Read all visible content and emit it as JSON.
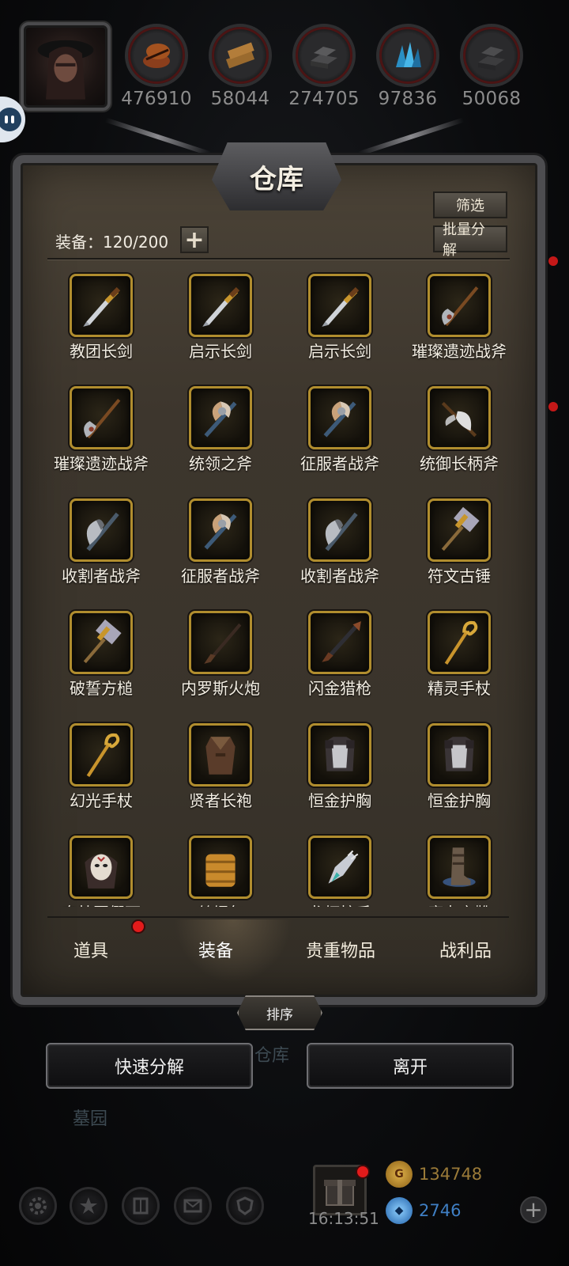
{
  "resources": [
    {
      "icon": "leather-icon",
      "value": "476910"
    },
    {
      "icon": "wood-plank-icon",
      "value": "58044"
    },
    {
      "icon": "iron-ingot-icon",
      "value": "274705"
    },
    {
      "icon": "crystal-icon",
      "value": "97836"
    },
    {
      "icon": "steel-ingot-icon",
      "value": "50068"
    }
  ],
  "panel": {
    "title": "仓库",
    "filter_label": "筛选",
    "batch_label": "批量分解",
    "capacity": "装备：120/200",
    "plus": "+"
  },
  "items": [
    {
      "name": "教团长剑",
      "icon": "sword-icon"
    },
    {
      "name": "启示长剑",
      "icon": "sword-icon"
    },
    {
      "name": "启示长剑",
      "icon": "sword-icon"
    },
    {
      "name": "璀璨遗迹战斧",
      "icon": "halberd-icon"
    },
    {
      "name": "璀璨遗迹战斧",
      "icon": "halberd-icon"
    },
    {
      "name": "统领之斧",
      "icon": "double-axe-icon"
    },
    {
      "name": "征服者战斧",
      "icon": "double-axe-icon"
    },
    {
      "name": "统御长柄斧",
      "icon": "poleaxe-icon"
    },
    {
      "name": "收割者战斧",
      "icon": "axe-icon"
    },
    {
      "name": "征服者战斧",
      "icon": "double-axe-icon"
    },
    {
      "name": "收割者战斧",
      "icon": "axe-icon"
    },
    {
      "name": "符文古锤",
      "icon": "hammer-icon"
    },
    {
      "name": "破誓方槌",
      "icon": "hammer-icon"
    },
    {
      "name": "内罗斯火炮",
      "icon": "musket-icon"
    },
    {
      "name": "闪金猎枪",
      "icon": "shotgun-icon"
    },
    {
      "name": "精灵手杖",
      "icon": "staff-icon"
    },
    {
      "name": "幻光手杖",
      "icon": "staff-icon"
    },
    {
      "name": "贤者长袍",
      "icon": "robe-icon"
    },
    {
      "name": "恒金护胸",
      "icon": "chest-armor-icon"
    },
    {
      "name": "恒金护胸",
      "icon": "chest-armor-icon"
    },
    {
      "name": "奥杜因假面",
      "icon": "mask-icon"
    },
    {
      "name": "丝绸包",
      "icon": "bag-icon"
    },
    {
      "name": "龙虾护手",
      "icon": "gauntlet-icon"
    },
    {
      "name": "魔力之靴",
      "icon": "boots-icon"
    }
  ],
  "tabs": [
    {
      "label": "道具",
      "active": false,
      "badge": true
    },
    {
      "label": "装备",
      "active": true,
      "badge": false
    },
    {
      "label": "贵重物品",
      "active": false,
      "badge": false
    },
    {
      "label": "战利品",
      "active": false,
      "badge": false
    }
  ],
  "sort_label": "排序",
  "quick_decompose_label": "快速分解",
  "leave_label": "离开",
  "background": {
    "warehouse_label": "仓库",
    "graveyard_label": "墓园"
  },
  "bottom": {
    "clock": "16:13:51",
    "gold_amount": "134748",
    "gem_amount": "2746",
    "gold_color": "#b5892c",
    "gem_color": "#3f7fc4"
  }
}
